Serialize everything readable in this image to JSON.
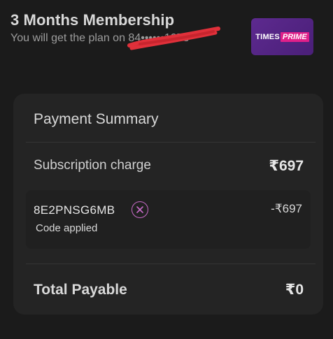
{
  "plan": {
    "title": "3 Months Membership",
    "subtitle_prefix": "You will get the plan on ",
    "subtitle_masked": "84••••••1073"
  },
  "logo": {
    "text": "TIMES",
    "accent": "PRIME",
    "bg_color": "#4f2282",
    "accent_color": "#e0208a"
  },
  "summary": {
    "title": "Payment Summary",
    "subscription_label": "Subscription charge",
    "subscription_value": "₹697",
    "coupon": {
      "code": "8E2PNSG6MB",
      "status": "Code applied",
      "discount": "-₹697",
      "remove_icon": "close-circle-icon",
      "icon_color": "#c86bc8"
    },
    "total_label": "Total Payable",
    "total_value": "₹0"
  }
}
